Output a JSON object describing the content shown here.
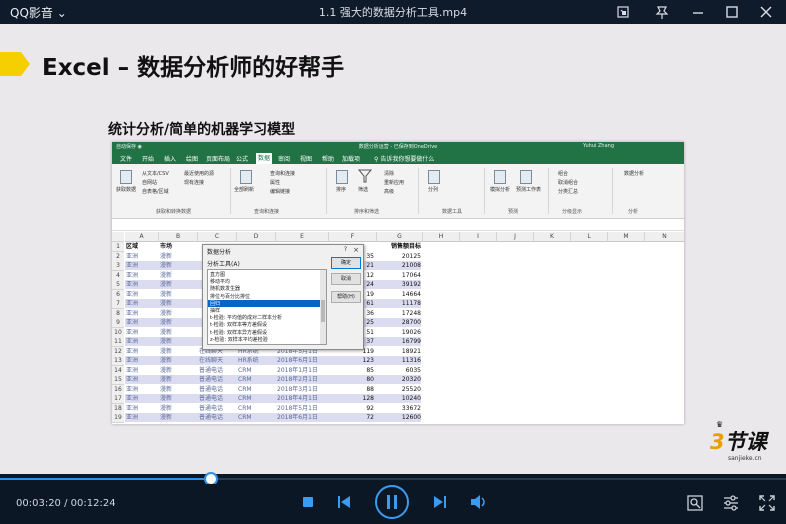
{
  "player": {
    "app_name": "QQ影音",
    "file_name": "1.1 强大的数据分析工具.mp4",
    "current_time": "00:03:20",
    "total_time": "00:12:24",
    "progress": 0.269,
    "accent_color": "#2f8fe6"
  },
  "slide": {
    "title": "Excel – 数据分析师的好帮手",
    "subtitle": "统计分析/简单的机器学习模型",
    "accent_color": "#f5cf00"
  },
  "excel": {
    "title": "数据分析运营 - 已保存到OneDrive",
    "user": "Yuhui Zhang",
    "autosave": "自动保存",
    "tabs": [
      "文件",
      "开始",
      "插入",
      "绘图",
      "页面布局",
      "公式",
      "数据",
      "审阅",
      "视图",
      "帮助",
      "加载项"
    ],
    "active_tab": "数据",
    "tell_me": "告诉我你想要做什么",
    "ribbon": {
      "get_data": "获取数据",
      "from_text_csv": "从文本/CSV",
      "from_web": "自网站",
      "from_table": "自表格/区域",
      "recent_sources": "最近使用的源",
      "existing_connections": "现有连接",
      "group_get_transform": "获取和转换数据",
      "refresh_all": "全部刷新",
      "queries_connections": "查询和连接",
      "properties": "属性",
      "edit_links": "编辑链接",
      "group_queries": "查询和连接",
      "sort": "排序",
      "filter": "筛选",
      "clear": "清除",
      "reapply": "重新应用",
      "advanced": "高级",
      "group_sort_filter": "排序和筛选",
      "text_to_columns": "分列",
      "group_data_tools": "数据工具",
      "what_if": "模拟分析",
      "forecast_sheet": "预测工作表",
      "group_forecast": "预测",
      "group_btn": "组合",
      "ungroup_btn": "取消组合",
      "subtotal": "分类汇总",
      "group_outline": "分级显示",
      "data_analysis": "数据分析",
      "group_analysis": "分析"
    },
    "columns": [
      "A",
      "B",
      "C",
      "D",
      "E",
      "F",
      "G",
      "H",
      "I",
      "J",
      "K",
      "L",
      "M",
      "N"
    ],
    "headers": [
      "区域",
      "市场",
      "",
      "",
      "",
      "",
      "销售额目标"
    ],
    "rows": [
      [
        "亚洲",
        "漫新",
        "",
        "",
        "",
        "35",
        "20125"
      ],
      [
        "亚洲",
        "漫新",
        "",
        "",
        "",
        "21",
        "21008"
      ],
      [
        "亚洲",
        "漫新",
        "",
        "",
        "",
        "12",
        "17064"
      ],
      [
        "亚洲",
        "漫新",
        "",
        "",
        "",
        "24",
        "39192"
      ],
      [
        "亚洲",
        "漫新",
        "",
        "",
        "",
        "19",
        "14664"
      ],
      [
        "亚洲",
        "漫新",
        "",
        "",
        "",
        "61",
        "11178"
      ],
      [
        "亚洲",
        "漫新",
        "",
        "",
        "",
        "36",
        "17248"
      ],
      [
        "亚洲",
        "漫新",
        "",
        "",
        "",
        "25",
        "28700"
      ],
      [
        "亚洲",
        "漫新",
        "",
        "",
        "",
        "51",
        "19026"
      ],
      [
        "亚洲",
        "漫新",
        "",
        "",
        "",
        "37",
        "16799"
      ],
      [
        "亚洲",
        "漫新",
        "在线聊天",
        "HR系统",
        "2018年5月1日",
        "119",
        "18921"
      ],
      [
        "亚洲",
        "漫新",
        "在线聊天",
        "HR系统",
        "2018年6月1日",
        "123",
        "11316"
      ],
      [
        "亚洲",
        "漫新",
        "普通电话",
        "CRM",
        "2018年1月1日",
        "85",
        "6035"
      ],
      [
        "亚洲",
        "漫新",
        "普通电话",
        "CRM",
        "2018年2月1日",
        "80",
        "20320"
      ],
      [
        "亚洲",
        "漫新",
        "普通电话",
        "CRM",
        "2018年3月1日",
        "88",
        "25520"
      ],
      [
        "亚洲",
        "漫新",
        "普通电话",
        "CRM",
        "2018年4月1日",
        "128",
        "10240"
      ],
      [
        "亚洲",
        "漫新",
        "普通电话",
        "CRM",
        "2018年5月1日",
        "92",
        "33672"
      ],
      [
        "亚洲",
        "漫新",
        "普通电话",
        "CRM",
        "2018年6月1日",
        "72",
        "12600"
      ]
    ],
    "dialog": {
      "title": "数据分析",
      "help_q": "?",
      "close": "×",
      "label": "分析工具(A)",
      "items": [
        "直方图",
        "移动平均",
        "随机数发生器",
        "排位与百分比排位",
        "回归",
        "抽样",
        "t-检验: 平均值的成对二样本分析",
        "t-检验: 双样本等方差假设",
        "t-检验: 双样本异方差假设",
        "z-检验: 双样本平均差检验"
      ],
      "selected_index": 4,
      "ok": "确定",
      "cancel": "取消",
      "help": "帮助(H)"
    }
  },
  "logo": {
    "main_digit": "3",
    "main_text": "节课",
    "sub": "sanjieke.cn",
    "crown": "♛"
  }
}
